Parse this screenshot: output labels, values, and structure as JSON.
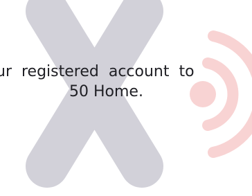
{
  "message": {
    "line_1": "ur registered account to",
    "line_2": "50 Home."
  },
  "icons": {
    "cross": "x-mark-icon",
    "signal": "wireless-signal-icon"
  },
  "colors": {
    "background": "#ffffff",
    "cross": "#d2d1d9",
    "signal": "#f8d3d3",
    "text": "#1f1f24"
  }
}
